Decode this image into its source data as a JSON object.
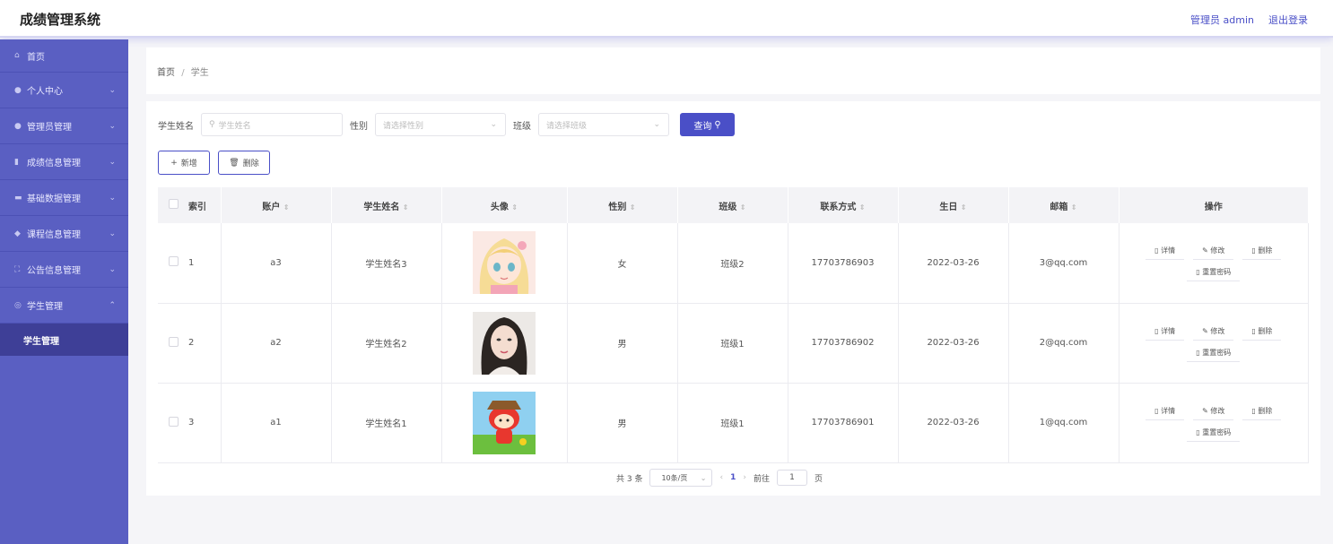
{
  "header": {
    "app_title": "成绩管理系统",
    "user_label": "管理员 admin",
    "logout_label": "退出登录"
  },
  "sidebar": {
    "items": [
      {
        "label": "首页",
        "icon": "home-icon"
      },
      {
        "label": "个人中心",
        "icon": "user-icon"
      },
      {
        "label": "管理员管理",
        "icon": "user-icon"
      },
      {
        "label": "成绩信息管理",
        "icon": "chart-icon"
      },
      {
        "label": "基础数据管理",
        "icon": "database-icon"
      },
      {
        "label": "课程信息管理",
        "icon": "pin-icon"
      },
      {
        "label": "公告信息管理",
        "icon": "frame-icon"
      },
      {
        "label": "学生管理",
        "icon": "circle-icon"
      }
    ],
    "sub_item": "学生管理"
  },
  "breadcrumb": {
    "home": "首页",
    "separator": "/",
    "current": "学生"
  },
  "search": {
    "name_label": "学生姓名",
    "name_placeholder": "学生姓名",
    "gender_label": "性别",
    "gender_placeholder": "请选择性别",
    "class_label": "班级",
    "class_placeholder": "请选择班级",
    "query_button": "查询"
  },
  "actions": {
    "add_label": "新增",
    "delete_label": "删除"
  },
  "table": {
    "headers": [
      "索引",
      "账户",
      "学生姓名",
      "头像",
      "性别",
      "班级",
      "联系方式",
      "生日",
      "邮箱",
      "操作"
    ],
    "rows": [
      {
        "index": "1",
        "account": "a3",
        "name": "学生姓名3",
        "gender": "女",
        "class": "班级2",
        "phone": "17703786903",
        "birthday": "2022-03-26",
        "email": "3@qq.com"
      },
      {
        "index": "2",
        "account": "a2",
        "name": "学生姓名2",
        "gender": "男",
        "class": "班级1",
        "phone": "17703786902",
        "birthday": "2022-03-26",
        "email": "2@qq.com"
      },
      {
        "index": "3",
        "account": "a1",
        "name": "学生姓名1",
        "gender": "男",
        "class": "班级1",
        "phone": "17703786901",
        "birthday": "2022-03-26",
        "email": "1@qq.com"
      }
    ],
    "op_labels": {
      "detail": "详情",
      "edit": "修改",
      "delete": "删除",
      "reset": "重置密码"
    }
  },
  "pagination": {
    "total": "共 3 条",
    "page_size": "10条/页",
    "current_page": "1",
    "goto_label": "前往",
    "goto_value": "1",
    "page_suffix": "页"
  },
  "colors": {
    "accent": "#4a4fc7",
    "sidebar": "#5a5fc2",
    "sidebar_active": "#3e3f97"
  }
}
